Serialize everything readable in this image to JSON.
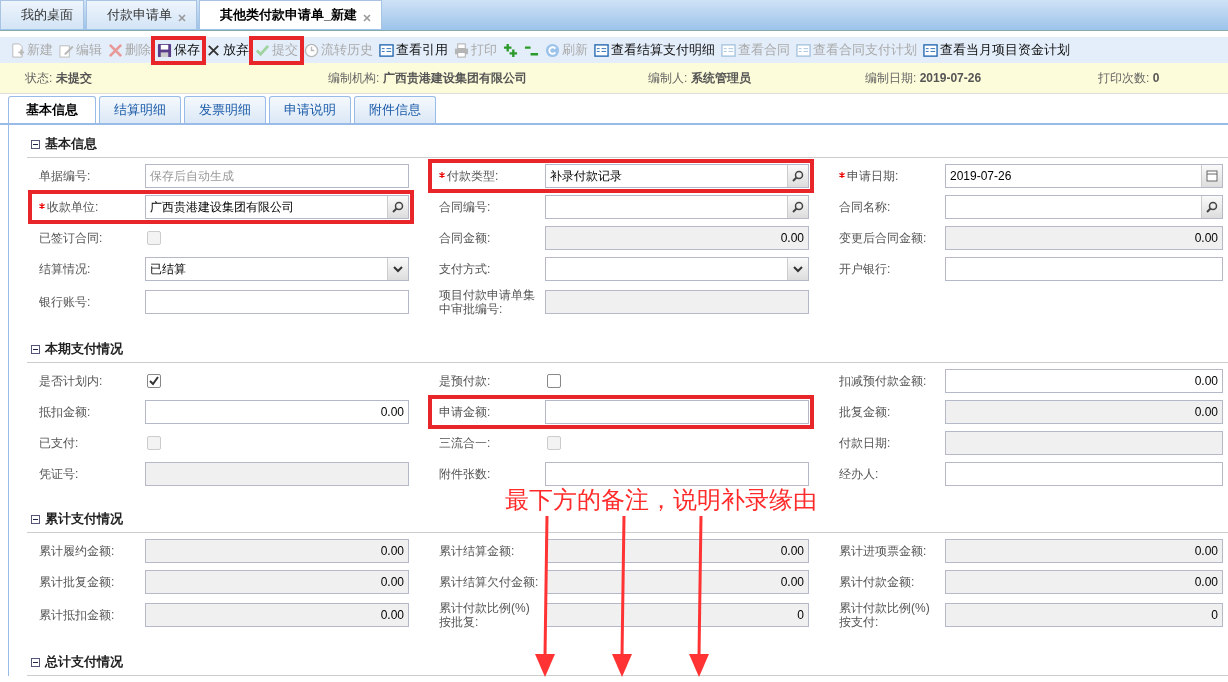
{
  "tabs": [
    {
      "label": "我的桌面",
      "selected": false,
      "closable": false
    },
    {
      "label": "付款申请单",
      "selected": false,
      "closable": true
    },
    {
      "label": "其他类付款申请单_新建",
      "selected": true,
      "closable": true
    }
  ],
  "toolbar": [
    {
      "label": "新建",
      "kind": "new",
      "disabled": true,
      "highlighted": false
    },
    {
      "label": "编辑",
      "kind": "edit",
      "disabled": true,
      "highlighted": false
    },
    {
      "label": "删除",
      "kind": "delete",
      "disabled": true,
      "highlighted": false
    },
    {
      "label": "保存",
      "kind": "save",
      "disabled": false,
      "highlighted": true
    },
    {
      "label": "放弃",
      "kind": "discard",
      "disabled": false,
      "highlighted": false
    },
    {
      "label": "提交",
      "kind": "submit",
      "disabled": true,
      "highlighted": true
    },
    {
      "label": "流转历史",
      "kind": "history",
      "disabled": true,
      "highlighted": false
    },
    {
      "label": "查看引用",
      "kind": "view",
      "disabled": false,
      "highlighted": false
    },
    {
      "label": "打印",
      "kind": "print",
      "disabled": true,
      "highlighted": false
    },
    {
      "kind": "add",
      "disabled": false,
      "highlighted": false
    },
    {
      "kind": "remove",
      "disabled": false,
      "highlighted": false
    },
    {
      "label": "刷新",
      "kind": "refresh",
      "disabled": true,
      "highlighted": false
    },
    {
      "label": "查看结算支付明细",
      "kind": "view",
      "disabled": false,
      "highlighted": false
    },
    {
      "label": "查看合同",
      "kind": "view",
      "disabled": true,
      "highlighted": false
    },
    {
      "label": "查看合同支付计划",
      "kind": "view",
      "disabled": true,
      "highlighted": false
    },
    {
      "label": "查看当月项目资金计划",
      "kind": "view",
      "disabled": false,
      "highlighted": false
    }
  ],
  "status_bar": [
    {
      "label": "状态:",
      "value": "未提交"
    },
    {
      "label": "编制机构:",
      "value": "广西贵港建设集团有限公司"
    },
    {
      "label": "编制人:",
      "value": "系统管理员"
    },
    {
      "label": "编制日期:",
      "value": "2019-07-26"
    },
    {
      "label": "打印次数:",
      "value": "0"
    }
  ],
  "form_tabs": [
    {
      "label": "基本信息",
      "selected": true
    },
    {
      "label": "结算明细",
      "selected": false
    },
    {
      "label": "发票明细",
      "selected": false
    },
    {
      "label": "申请说明",
      "selected": false
    },
    {
      "label": "附件信息",
      "selected": false
    }
  ],
  "sections": [
    {
      "title": "基本信息",
      "fields": [
        {
          "label": "单据编号:",
          "kind": "text",
          "placeholder": "保存后自动生成"
        },
        {
          "label": "付款类型:",
          "kind": "lookup",
          "required": true,
          "highlighted": true,
          "value": "补录付款记录"
        },
        {
          "label": "申请日期:",
          "kind": "date",
          "required": true,
          "value": "2019-07-26"
        },
        {
          "label": "收款单位:",
          "kind": "lookup",
          "required": true,
          "highlighted": true,
          "value": "广西贵港建设集团有限公司"
        },
        {
          "label": "合同编号:",
          "kind": "lookup"
        },
        {
          "label": "合同名称:",
          "kind": "lookup"
        },
        {
          "label": "已签订合同:",
          "kind": "checkbox",
          "checked": false,
          "disabled": true
        },
        {
          "label": "合同金额:",
          "kind": "text",
          "readonly": true,
          "numeric": true,
          "value": "0.00"
        },
        {
          "label": "变更后合同金额:",
          "kind": "text",
          "readonly": true,
          "numeric": true,
          "value": "0.00"
        },
        {
          "label": "结算情况:",
          "kind": "select",
          "value": "已结算"
        },
        {
          "label": "支付方式:",
          "kind": "select"
        },
        {
          "label": "开户银行:",
          "kind": "text"
        },
        {
          "label": "银行账号:",
          "kind": "text"
        },
        {
          "label": "项目付款申请单集中审批编号:",
          "kind": "text",
          "readonly": true
        }
      ]
    },
    {
      "title": "本期支付情况",
      "fields": [
        {
          "label": "是否计划内:",
          "kind": "checkbox",
          "checked": true,
          "disabled": false
        },
        {
          "label": "是预付款:",
          "kind": "checkbox",
          "checked": false,
          "disabled": false
        },
        {
          "label": "扣减预付款金额:",
          "kind": "text",
          "numeric": true,
          "value": "0.00"
        },
        {
          "label": "抵扣金额:",
          "kind": "text",
          "numeric": true,
          "value": "0.00"
        },
        {
          "label": "申请金额:",
          "kind": "text",
          "highlighted": true
        },
        {
          "label": "批复金额:",
          "kind": "text",
          "readonly": true,
          "numeric": true,
          "value": "0.00"
        },
        {
          "label": "已支付:",
          "kind": "checkbox",
          "checked": false,
          "disabled": true
        },
        {
          "label": "三流合一:",
          "kind": "checkbox",
          "checked": false,
          "disabled": true
        },
        {
          "label": "付款日期:",
          "kind": "text",
          "readonly": true
        },
        {
          "label": "凭证号:",
          "kind": "text",
          "readonly": true
        },
        {
          "label": "附件张数:",
          "kind": "text"
        },
        {
          "label": "经办人:",
          "kind": "text"
        }
      ]
    },
    {
      "title": "累计支付情况",
      "fields": [
        {
          "label": "累计履约金额:",
          "kind": "text",
          "readonly": true,
          "numeric": true,
          "value": "0.00"
        },
        {
          "label": "累计结算金额:",
          "kind": "text",
          "readonly": true,
          "numeric": true,
          "value": "0.00"
        },
        {
          "label": "累计进项票金额:",
          "kind": "text",
          "readonly": true,
          "numeric": true,
          "value": "0.00"
        },
        {
          "label": "累计批复金额:",
          "kind": "text",
          "readonly": true,
          "numeric": true,
          "value": "0.00"
        },
        {
          "label": "累计结算欠付金额:",
          "kind": "text",
          "readonly": true,
          "numeric": true,
          "value": "0.00"
        },
        {
          "label": "累计付款金额:",
          "kind": "text",
          "readonly": true,
          "numeric": true,
          "value": "0.00"
        },
        {
          "label": "累计抵扣金额:",
          "kind": "text",
          "readonly": true,
          "numeric": true,
          "value": "0.00"
        },
        {
          "label": "累计付款比例(%)按批复:",
          "kind": "text",
          "readonly": true,
          "numeric": true,
          "value": "0"
        },
        {
          "label": "累计付款比例(%)按支付:",
          "kind": "text",
          "readonly": true,
          "numeric": true,
          "value": "0"
        }
      ]
    },
    {
      "title": "总计支付情况"
    }
  ],
  "annotation": {
    "text": "最下方的备注，说明补录缘由"
  }
}
